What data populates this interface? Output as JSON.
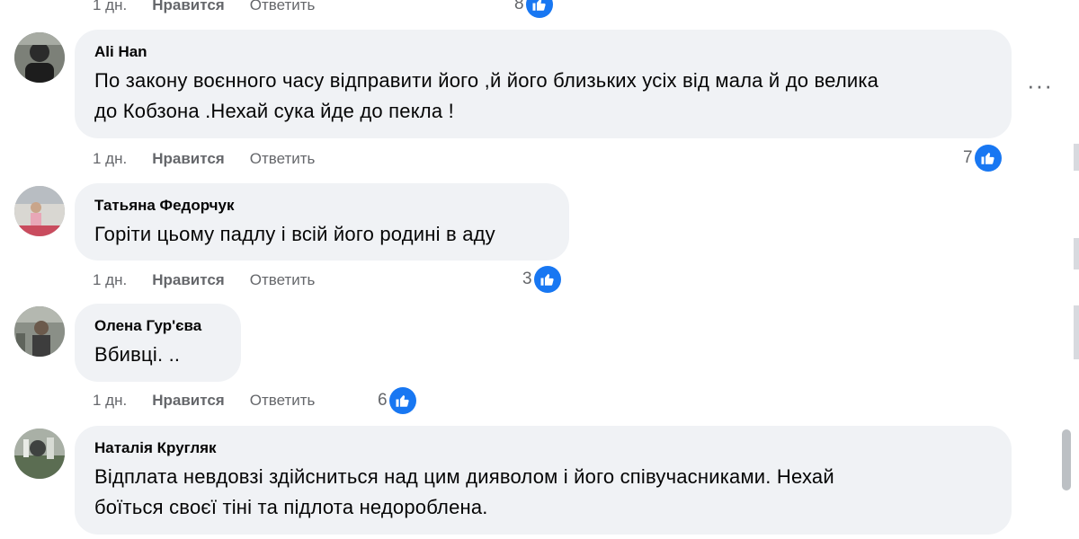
{
  "top_actions": {
    "time": "1 дн.",
    "like": "Нравится",
    "reply": "Ответить",
    "count": "8"
  },
  "comments": [
    {
      "author": "Ali Han",
      "lines": [
        "По закону воєнного часу відправити його ,й його близьких усіх від мала й до велика",
        "до Кобзона .Нехай сука йде до пекла !"
      ],
      "time": "1 дн.",
      "like": "Нравится",
      "reply": "Ответить",
      "reactions": "7",
      "more": "···"
    },
    {
      "author": "Татьяна Федорчук",
      "lines": [
        "Горіти цьому падлу і всій його родині в аду"
      ],
      "time": "1 дн.",
      "like": "Нравится",
      "reply": "Ответить",
      "reactions": "3"
    },
    {
      "author": "Олена Гур'єва",
      "lines": [
        "Вбивці. .."
      ],
      "time": "1 дн.",
      "like": "Нравится",
      "reply": "Ответить",
      "reactions": "6"
    },
    {
      "author": "Наталія Кругляк",
      "lines": [
        "Відплата невдовзі здійсниться над цим дияволом і його співучасниками. Нехай",
        "боїться своєї тіні та підлота недороблена."
      ]
    }
  ],
  "icons": {
    "reaction": "like-thumb-icon",
    "more": "more-options-icon"
  },
  "colors": {
    "bubble": "#f0f2f5",
    "meta_text": "#65676b",
    "like_blue": "#1877f2",
    "scroll_thumb": "#bcc0c4"
  }
}
